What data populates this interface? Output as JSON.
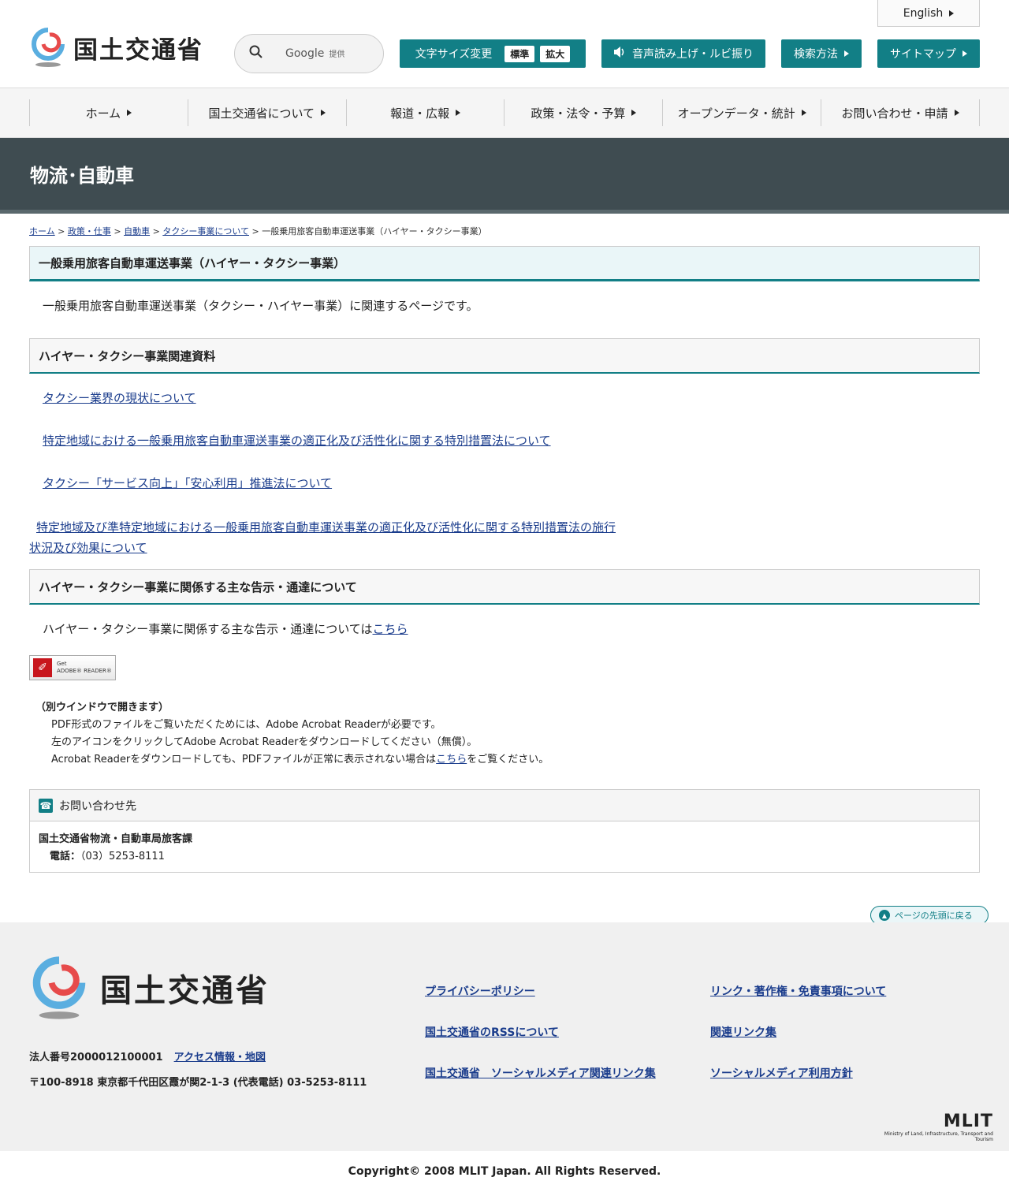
{
  "header": {
    "site_title": "国土交通省",
    "lang_label": "English",
    "search": {
      "provider": "Google",
      "provided": "提供"
    },
    "font_size": {
      "label": "文字サイズ変更",
      "standard": "標準",
      "large": "拡大"
    },
    "read_aloud": "音声読み上げ・ルビ振り",
    "search_method": "検索方法",
    "sitemap": "サイトマップ"
  },
  "gnav": [
    "ホーム",
    "国土交通省について",
    "報道・広報",
    "政策・法令・予算",
    "オープンデータ・統計",
    "お問い合わせ・申請"
  ],
  "band_title": "物流･自動車",
  "breadcrumb": {
    "items": [
      "ホーム",
      "政策・仕事",
      "自動車",
      "タクシー事業について"
    ],
    "sep": ">",
    "current": "一般乗用旅客自動車運送事業（ハイヤー・タクシー事業）"
  },
  "main": {
    "title": "一般乗用旅客自動車運送事業（ハイヤー・タクシー事業）",
    "lead": "一般乗用旅客自動車運送事業（タクシー・ハイヤー事業）に関連するページです。",
    "section1": {
      "title": "ハイヤー・タクシー事業関連資料",
      "links": [
        "タクシー業界の現状について",
        "特定地域における一般乗用旅客自動車運送事業の適正化及び活性化に関する特別措置法について",
        "タクシー「サービス向上」「安心利用」推進法について",
        "特定地域及び準特定地域における一般乗用旅客自動車運送事業の適正化及び活性化に関する特別措置法の施行",
        "状況及び効果について"
      ]
    },
    "section2": {
      "title": "ハイヤー・タクシー事業に関係する主な告示・通達について",
      "text": "ハイヤー・タクシー事業に関係する主な告示・通達については",
      "link": "こちら"
    },
    "adobe": {
      "get": "Get",
      "brand": "ADOBE® READER®"
    },
    "pdf_note": {
      "heading": "（別ウインドウで開きます）",
      "line1": "PDF形式のファイルをご覧いただくためには、Adobe Acrobat Readerが必要です。",
      "line2": "左のアイコンをクリックしてAdobe Acrobat Readerをダウンロードしてください（無償）。",
      "line3_pre": "Acrobat Readerをダウンロードしても、PDFファイルが正常に表示されない場合は",
      "line3_link": "こちら",
      "line3_post": "をご覧ください。"
    },
    "contact": {
      "heading": "お問い合わせ先",
      "org": "国土交通省物流・自動車局旅客課",
      "tel_label": "電話：",
      "tel": "（03）5253-8111"
    }
  },
  "back_to_top": "ページの先頭に戻る",
  "footer": {
    "site_title": "国土交通省",
    "corp_no": "法人番号2000012100001",
    "access": "アクセス情報・地図",
    "address": "〒100-8918 東京都千代田区霞が関2-1-3 (代表電話) 03-5253-8111",
    "links_col1": [
      "プライバシーポリシー",
      "国土交通省のRSSについて",
      "国土交通省　ソーシャルメディア関連リンク集"
    ],
    "links_col2": [
      "リンク・著作権・免責事項について",
      "関連リンク集",
      "ソーシャルメディア利用方針"
    ],
    "mlit": "MLIT",
    "mlit_sub": "Ministry of Land, Infrastructure, Transport and Tourism",
    "copyright": "Copyright© 2008 MLIT Japan. All Rights Reserved."
  },
  "colors": {
    "accent": "#127f86",
    "band": "#3f4c51",
    "link": "#1a3c8c"
  }
}
